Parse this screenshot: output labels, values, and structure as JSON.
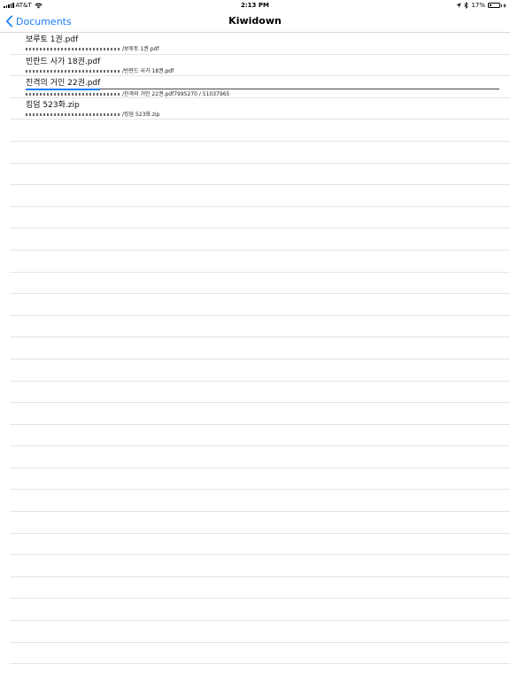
{
  "status_bar": {
    "carrier": "AT&T",
    "time": "2:13 PM",
    "battery_percent": "17%",
    "battery_level": 0.17
  },
  "nav": {
    "back_label": "Documents",
    "title": "Kiwidown"
  },
  "downloads": [
    {
      "name": "보루토 1권.pdf",
      "path": "/보루토 1권.pdf",
      "progress": null
    },
    {
      "name": "빈란드 사가 18권.pdf",
      "path": "/빈란드 사가 18권.pdf",
      "progress": null
    },
    {
      "name": "진격의 거인 22권.pdf",
      "path": "/진격의 거인 22권.pdf7995270 / 51037965",
      "progress": 0.157
    },
    {
      "name": "킹덤 523화.zip",
      "path": "/킹덤 523화.zip",
      "progress": null
    }
  ],
  "empty_row_count": 25
}
